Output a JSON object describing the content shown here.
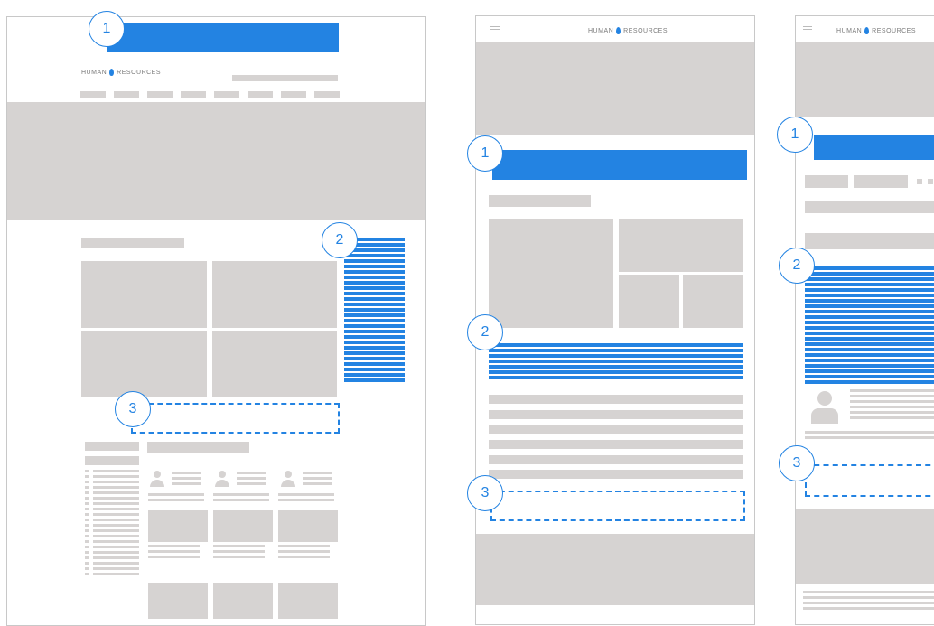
{
  "logo": {
    "text": "HUMAN",
    "text2": "RESOURCES",
    "sub": "■ ■ ■ ■ ■"
  },
  "markers": {
    "one": "1",
    "two": "2",
    "three": "3"
  },
  "colors": {
    "accent": "#2383e2",
    "placeholder": "#d6d3d2",
    "frame_border": "#c8c8c8"
  },
  "layouts": [
    "desktop-wireframe",
    "tablet-wireframe",
    "mobile-wireframe"
  ],
  "icons": [
    "hamburger-menu-icon",
    "user-avatar-icon"
  ]
}
